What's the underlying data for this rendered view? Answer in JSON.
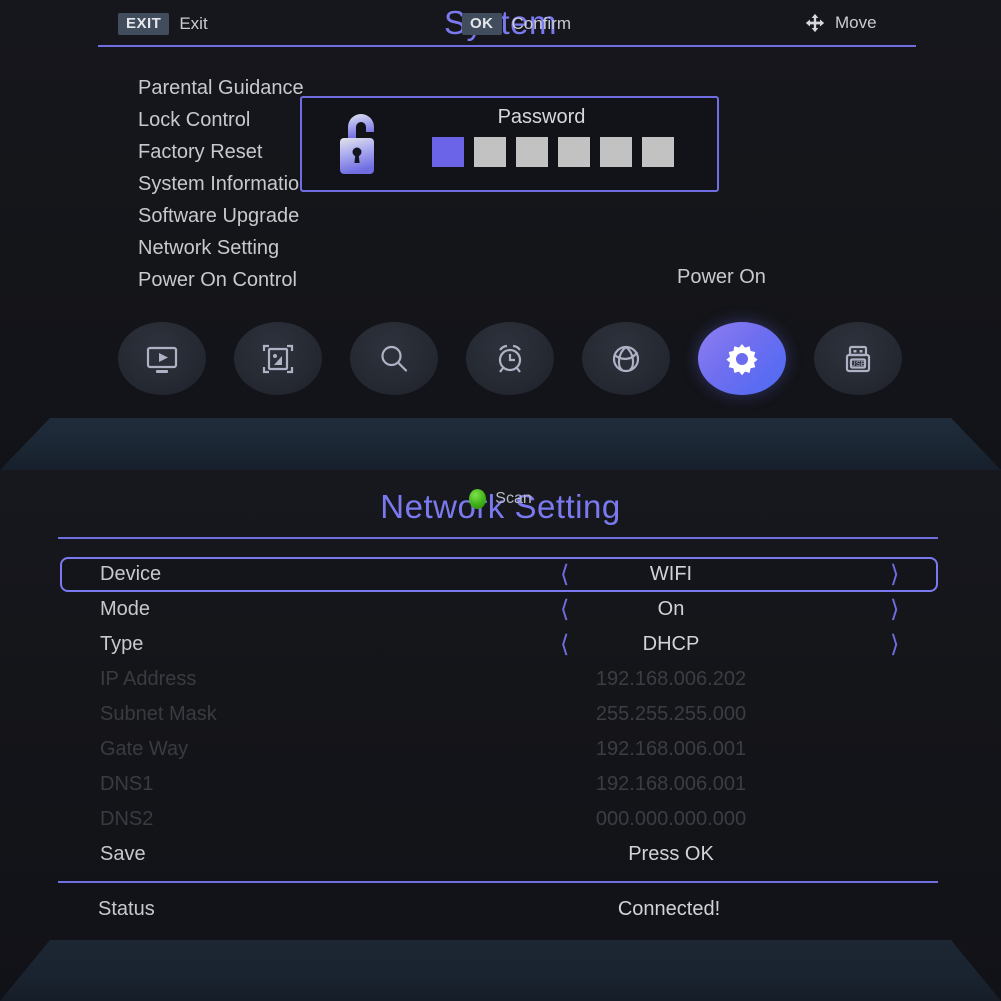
{
  "system_panel": {
    "title": "System",
    "menu_items": [
      {
        "label": "Parental Guidance"
      },
      {
        "label": "Lock Control"
      },
      {
        "label": "Factory Reset"
      },
      {
        "label": "System Information"
      },
      {
        "label": "Software Upgrade"
      },
      {
        "label": "Network Setting"
      },
      {
        "label": "Power On Control"
      }
    ],
    "power_on_value": "Power On",
    "password_dialog": {
      "label": "Password",
      "icon": "unlocked-padlock-icon",
      "box_count": 6,
      "filled_count": 1,
      "filled_color": "#6b63e8",
      "empty_color": "#c2c2c2"
    },
    "dock": {
      "selected_index": 5,
      "selected_color": "#6f6ef0",
      "icons": [
        {
          "name": "tv-media-icon",
          "label": "Media Player"
        },
        {
          "name": "picture-icon",
          "label": "Picture"
        },
        {
          "name": "search-icon",
          "label": "Search"
        },
        {
          "name": "alarm-clock-icon",
          "label": "Timer"
        },
        {
          "name": "globe-icon",
          "label": "Network"
        },
        {
          "name": "gear-icon",
          "label": "System"
        },
        {
          "name": "usb-icon",
          "label": "USB"
        }
      ]
    },
    "hints": [
      {
        "key": "EXIT",
        "label": "Exit"
      },
      {
        "key": "OK",
        "label": "Confirm"
      },
      {
        "key": "",
        "label": "Move",
        "icon": "move-arrows-icon"
      }
    ]
  },
  "network_panel": {
    "title": "Network Setting",
    "rows": [
      {
        "label": "Device",
        "value": "WIFI",
        "selected": true,
        "dim": false,
        "arrows": true
      },
      {
        "label": "Mode",
        "value": "On",
        "selected": false,
        "dim": false,
        "arrows": true
      },
      {
        "label": "Type",
        "value": "DHCP",
        "selected": false,
        "dim": false,
        "arrows": true
      },
      {
        "label": "IP Address",
        "value": "192.168.006.202",
        "selected": false,
        "dim": true,
        "arrows": false
      },
      {
        "label": "Subnet Mask",
        "value": "255.255.255.000",
        "selected": false,
        "dim": true,
        "arrows": false
      },
      {
        "label": "Gate Way",
        "value": "192.168.006.001",
        "selected": false,
        "dim": true,
        "arrows": false
      },
      {
        "label": "DNS1",
        "value": "192.168.006.001",
        "selected": false,
        "dim": true,
        "arrows": false
      },
      {
        "label": "DNS2",
        "value": "000.000.000.000",
        "selected": false,
        "dim": true,
        "arrows": false
      },
      {
        "label": "Save",
        "value": "Press OK",
        "selected": false,
        "dim": false,
        "arrows": false
      }
    ],
    "status": {
      "label": "Status",
      "value": "Connected!"
    },
    "scan": {
      "label": "Scan",
      "dot_color": "#3faf17"
    }
  },
  "theme": {
    "accent": "#6f6de0",
    "title_color": "#7b79ef",
    "text_color": "#c8c9cd",
    "dim_text_color": "#3c3d44",
    "background": "#15161c"
  }
}
